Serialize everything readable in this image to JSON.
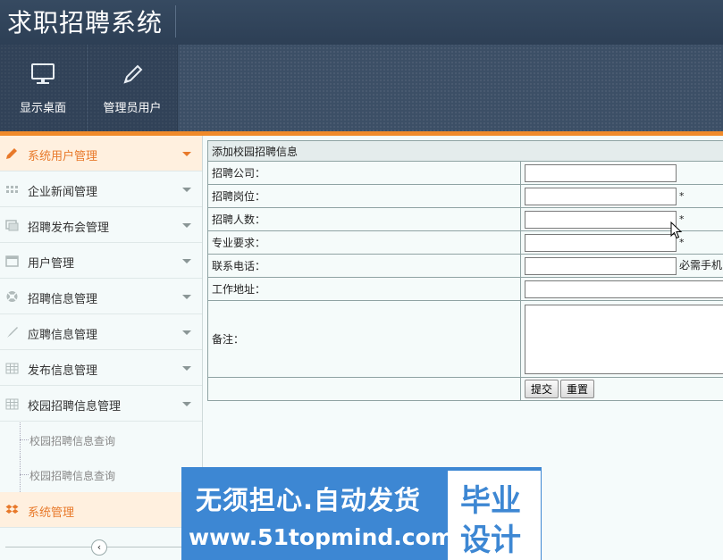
{
  "app": {
    "title": "求职招聘系统"
  },
  "toolbar": {
    "items": [
      {
        "label": "显示桌面",
        "icon": "monitor-icon"
      },
      {
        "label": "管理员用户",
        "icon": "pencil-icon"
      }
    ]
  },
  "sidebar": {
    "items": [
      {
        "label": "系统用户管理",
        "icon": "pencil-icon",
        "active": true
      },
      {
        "label": "企业新闻管理",
        "icon": "grid-icon"
      },
      {
        "label": "招聘发布会管理",
        "icon": "gallery-icon"
      },
      {
        "label": "用户管理",
        "icon": "calendar-icon"
      },
      {
        "label": "招聘信息管理",
        "icon": "lifebuoy-icon"
      },
      {
        "label": "应聘信息管理",
        "icon": "brush-icon"
      },
      {
        "label": "发布信息管理",
        "icon": "table-icon"
      },
      {
        "label": "校园招聘信息管理",
        "icon": "table-icon"
      }
    ],
    "subitems": [
      {
        "label": "校园招聘信息查询"
      },
      {
        "label": "校园招聘信息查询"
      }
    ],
    "footer_item": {
      "label": "系统管理",
      "icon": "dropbox-icon"
    },
    "collapse_glyph": "‹"
  },
  "form": {
    "title": "添加校园招聘信息",
    "fields": {
      "company": {
        "label": "招聘公司：",
        "value": ""
      },
      "position": {
        "label": "招聘岗位：",
        "value": "",
        "mark": "*"
      },
      "headcount": {
        "label": "招聘人数：",
        "value": "",
        "mark": "*"
      },
      "major": {
        "label": "专业要求：",
        "value": "",
        "mark": "*"
      },
      "phone": {
        "label": "联系电话：",
        "value": "",
        "note": "必需手机"
      },
      "address": {
        "label": "工作地址：",
        "value": ""
      },
      "remark": {
        "label": "备注：",
        "value": ""
      }
    },
    "submit_label": "提交",
    "reset_label": "重置"
  },
  "banner": {
    "slogan": "无须担心.自动发货",
    "url": "www.51topmind.com",
    "box_line1": "毕业",
    "box_line2": "设计"
  },
  "colors": {
    "accent": "#f08a2a",
    "header": "#3c4f66",
    "banner": "#3d87d3"
  }
}
